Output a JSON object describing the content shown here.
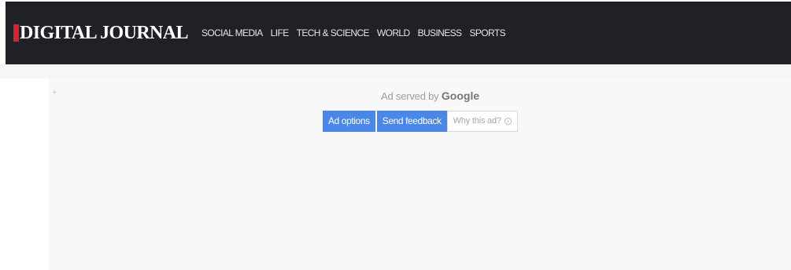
{
  "header": {
    "logo_text": "DIGITAL JOURNAL",
    "brand_color": "#d6262c",
    "background_color": "#1f2126",
    "nav": [
      {
        "label": "SOCIAL MEDIA"
      },
      {
        "label": "LIFE"
      },
      {
        "label": "TECH & SCIENCE"
      },
      {
        "label": "WORLD"
      },
      {
        "label": "BUSINESS"
      },
      {
        "label": "SPORTS"
      }
    ]
  },
  "ad": {
    "corner_glyph": "+",
    "served_by_text": "Ad served by",
    "served_by_brand": "Google",
    "buttons": {
      "ad_options": "Ad options",
      "send_feedback": "Send feedback",
      "why_this_ad": "Why this ad?"
    },
    "button_color": "#4a87e8",
    "icons": {
      "why_this_ad": "info-icon"
    }
  }
}
